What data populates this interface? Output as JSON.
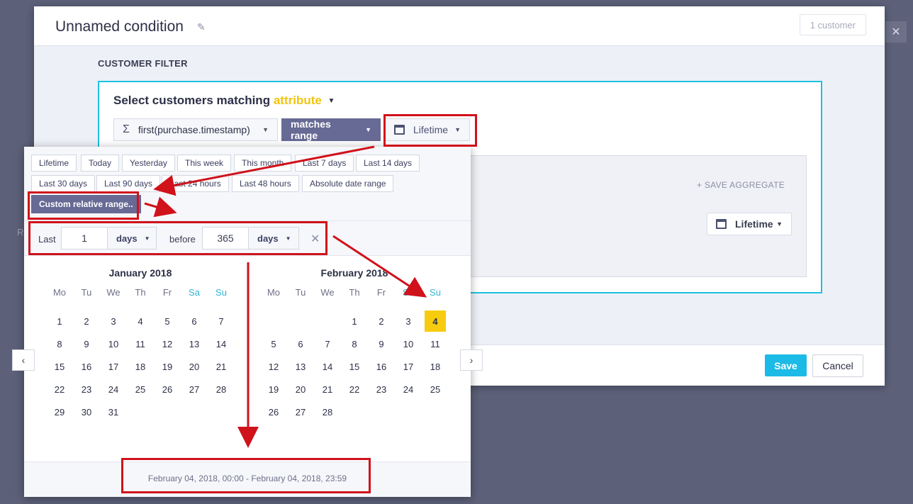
{
  "background": {
    "partial_text": "R"
  },
  "modal": {
    "title": "Unnamed condition",
    "customer_count": "1 customer",
    "section_label": "CUSTOMER FILTER",
    "filter": {
      "heading_prefix": "Select customers matching",
      "heading_accent": "attribute",
      "attribute_field": "first(purchase.timestamp)",
      "operator": "matches range",
      "range_value": "Lifetime",
      "save_aggregate": "+ SAVE AGGREGATE",
      "inner_range_value": "Lifetime"
    },
    "footer": {
      "save": "Save",
      "cancel": "Cancel"
    }
  },
  "date_picker": {
    "presets": [
      "Lifetime",
      "Today",
      "Yesterday",
      "This week",
      "This month",
      "Last 7 days",
      "Last 14 days",
      "Last 30 days",
      "Last 90 days",
      "Last 24 hours",
      "Last 48 hours",
      "Absolute date range"
    ],
    "custom_button": "Custom relative range..",
    "relative": {
      "last_label": "Last",
      "last_value": "1",
      "last_unit": "days",
      "before_label": "before",
      "before_value": "365",
      "before_unit": "days"
    },
    "weekdays": [
      "Mo",
      "Tu",
      "We",
      "Th",
      "Fr",
      "Sa",
      "Su"
    ],
    "months": [
      {
        "title": "January 2018",
        "weeks": [
          [
            "1",
            "2",
            "3",
            "4",
            "5",
            "6",
            "7"
          ],
          [
            "8",
            "9",
            "10",
            "11",
            "12",
            "13",
            "14"
          ],
          [
            "15",
            "16",
            "17",
            "18",
            "19",
            "20",
            "21"
          ],
          [
            "22",
            "23",
            "24",
            "25",
            "26",
            "27",
            "28"
          ],
          [
            "29",
            "30",
            "31",
            "",
            "",
            "",
            ""
          ]
        ]
      },
      {
        "title": "February 2018",
        "weeks": [
          [
            "",
            "",
            "",
            "1",
            "2",
            "3",
            "4"
          ],
          [
            "5",
            "6",
            "7",
            "8",
            "9",
            "10",
            "11"
          ],
          [
            "12",
            "13",
            "14",
            "15",
            "16",
            "17",
            "18"
          ],
          [
            "19",
            "20",
            "21",
            "22",
            "23",
            "24",
            "25"
          ],
          [
            "26",
            "27",
            "28",
            "",
            "",
            "",
            ""
          ]
        ]
      }
    ],
    "selected_day": "4",
    "selected_month_index": 1,
    "range_text": "February 04, 2018, 00:00 - February 04, 2018, 23:59"
  },
  "colors": {
    "accent": "#1cbae6",
    "highlight": "#d0121b",
    "selected_day": "#f7cc0e",
    "primary_button": "#676a94"
  }
}
